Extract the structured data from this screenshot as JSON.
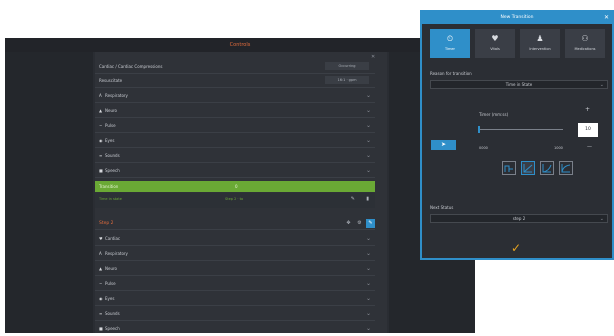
{
  "app": {
    "title": "Controls",
    "rows_top": [
      {
        "label": "Cardiac / Cardiac Compressions",
        "value": "Occurring"
      },
      {
        "label": "Resuscitate",
        "value": "16:1 · gpm"
      }
    ],
    "rows_step1": [
      {
        "icon": "lungs-icon",
        "glyph": "A",
        "label": "Respiratory"
      },
      {
        "icon": "brain-icon",
        "glyph": "▲",
        "label": "Neuro"
      },
      {
        "icon": "pulse-icon",
        "glyph": "∼",
        "label": "Pulse"
      },
      {
        "icon": "eye-icon",
        "glyph": "◉",
        "label": "Eyes"
      },
      {
        "icon": "sound-icon",
        "glyph": "≡",
        "label": "Sounds"
      },
      {
        "icon": "speech-icon",
        "glyph": "■",
        "label": "Speech"
      }
    ],
    "transition": {
      "label": "Transition",
      "badge": "0",
      "info": "Time in state",
      "target": "Step 2 · to"
    },
    "step2": {
      "title": "Step 2",
      "rows": [
        {
          "icon": "heart-icon",
          "glyph": "♥",
          "label": "Cardiac"
        },
        {
          "icon": "lungs-icon",
          "glyph": "A",
          "label": "Respiratory"
        },
        {
          "icon": "brain-icon",
          "glyph": "▲",
          "label": "Neuro"
        },
        {
          "icon": "pulse-icon",
          "glyph": "∼",
          "label": "Pulse"
        },
        {
          "icon": "eye-icon",
          "glyph": "◉",
          "label": "Eyes"
        },
        {
          "icon": "sound-icon",
          "glyph": "≡",
          "label": "Sounds"
        },
        {
          "icon": "speech-icon",
          "glyph": "■",
          "label": "Speech"
        }
      ]
    }
  },
  "dialog": {
    "title": "New Transition",
    "categories": [
      {
        "label": "Timer",
        "icon": "clock-icon",
        "glyph": "⏲",
        "selected": true
      },
      {
        "label": "Vitals",
        "icon": "heart-icon",
        "glyph": "♥",
        "selected": false
      },
      {
        "label": "Intervention",
        "icon": "person-icon",
        "glyph": "♟",
        "selected": false
      },
      {
        "label": "Medications",
        "icon": "pills-icon",
        "glyph": "⚇",
        "selected": false
      }
    ],
    "reason_label": "Reason for transition",
    "reason_value": "Time in State",
    "timer_label": "Timer (mm:ss)",
    "timer_value": "10",
    "min_label": "0000",
    "max_label": "1000",
    "plus": "+",
    "minus": "—",
    "next_status_label": "Next Status",
    "next_status_value": "step 2",
    "confirm": "✓",
    "accent": "#2f8fc9",
    "confirm_color": "#e6a31e"
  }
}
